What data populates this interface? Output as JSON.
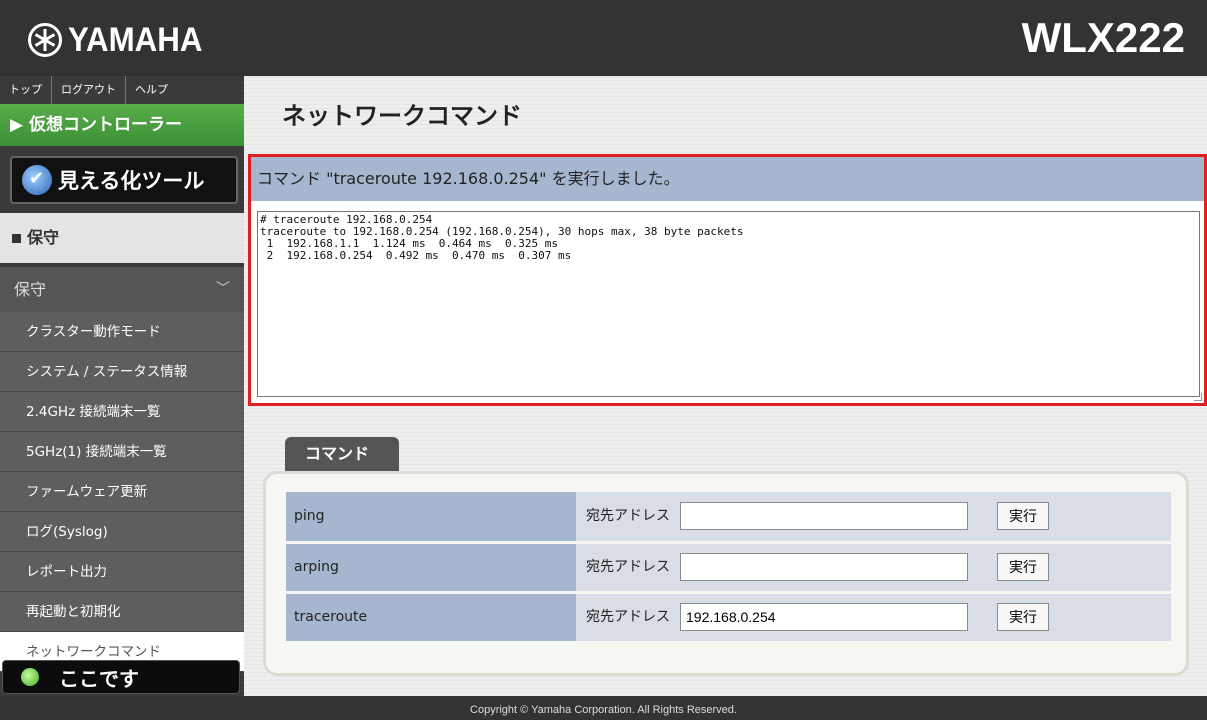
{
  "header": {
    "brand": "YAMAHA",
    "model": "WLX222"
  },
  "sidebar": {
    "topnav": [
      "トップ",
      "ログアウト",
      "ヘルプ"
    ],
    "virtual_controller": "▶ 仮想コントローラー",
    "visualization_tool": "見える化ツール",
    "section": "保守",
    "group": "保守",
    "group_chevron": "﹀",
    "items": [
      "クラスター動作モード",
      "システム / ステータス情報",
      "2.4GHz 接続端末一覧",
      "5GHz(1) 接続端末一覧",
      "ファームウェア更新",
      "ログ(Syslog)",
      "レポート出力",
      "再起動と初期化",
      "ネットワークコマンド"
    ],
    "active_index": 8,
    "here_label": "ここです"
  },
  "main": {
    "title": "ネットワークコマンド",
    "result_message": "コマンド \"traceroute 192.168.0.254\" を実行しました。",
    "result_output": "# traceroute 192.168.0.254\ntraceroute to 192.168.0.254 (192.168.0.254), 30 hops max, 38 byte packets\n 1  192.168.1.1  1.124 ms  0.464 ms  0.325 ms\n 2  192.168.0.254  0.492 ms  0.470 ms  0.307 ms",
    "tab_label": "コマンド",
    "commands": [
      {
        "name": "ping",
        "label": "宛先アドレス",
        "value": "",
        "button": "実行"
      },
      {
        "name": "arping",
        "label": "宛先アドレス",
        "value": "",
        "button": "実行"
      },
      {
        "name": "traceroute",
        "label": "宛先アドレス",
        "value": "192.168.0.254",
        "button": "実行"
      }
    ]
  },
  "footer": {
    "copyright": "Copyright © Yamaha Corporation. All Rights Reserved."
  },
  "colors": {
    "accent_red": "#e02020",
    "header_bg": "#333333",
    "table_header": "#a7b6cf",
    "green": "#4a9e3e"
  }
}
